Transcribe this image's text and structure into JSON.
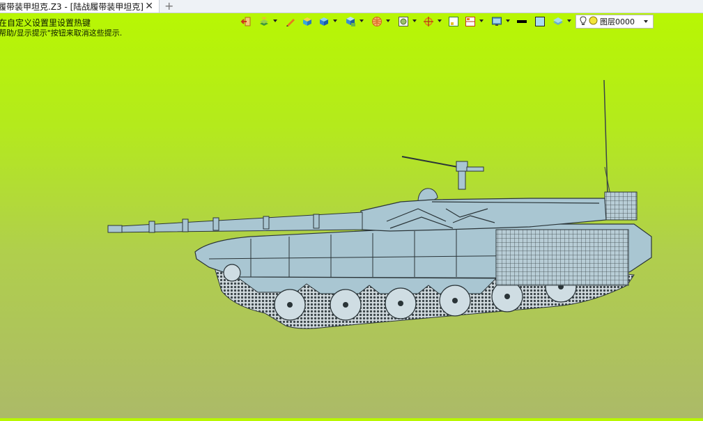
{
  "tab": {
    "title": "履带装甲坦克.Z3 - [陆战履带装甲坦克]",
    "close_glyph": "✕",
    "add_glyph": "+"
  },
  "hints": {
    "line1": "在自定义设置里设置热键",
    "line2": "帮助/显示提示\"按钮来取消这些提示."
  },
  "toolbar": {
    "buttons": [
      {
        "name": "exit-icon",
        "dropdown": false
      },
      {
        "name": "layers-stack-icon",
        "dropdown": true
      },
      {
        "name": "pen-icon",
        "dropdown": false
      },
      {
        "name": "box-yellow-icon",
        "dropdown": false
      },
      {
        "name": "box-blue-icon",
        "dropdown": true
      },
      {
        "name": "box-display-icon",
        "dropdown": true
      },
      {
        "name": "sphere-grid-icon",
        "dropdown": true
      },
      {
        "name": "render-frame-icon",
        "dropdown": true
      },
      {
        "name": "crosshair-icon",
        "dropdown": true
      },
      {
        "name": "view-single-icon",
        "dropdown": false
      },
      {
        "name": "view-split-icon",
        "dropdown": true
      },
      {
        "name": "monitor-icon",
        "dropdown": true
      },
      {
        "name": "line-weight-icon",
        "dropdown": false
      },
      {
        "name": "color-swatch-icon",
        "dropdown": false
      },
      {
        "name": "layer-plane-icon",
        "dropdown": true
      }
    ],
    "layer_value": "图层0000"
  },
  "colors": {
    "accent_orange": "#e8781c",
    "accent_blue": "#2f7fd6",
    "tank_fill": "#a9c6d2",
    "tank_line": "#2a3438"
  }
}
